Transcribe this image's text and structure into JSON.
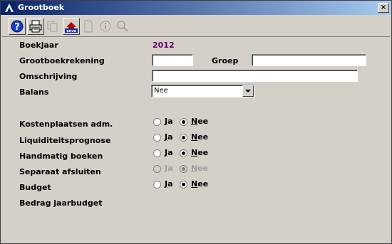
{
  "window": {
    "title": "Grootboek",
    "close": "×"
  },
  "toolbar": {
    "buttons": [
      {
        "icon": "help-icon",
        "enabled": true
      },
      {
        "icon": "print-icon",
        "enabled": true
      },
      {
        "icon": "copy-icon",
        "enabled": false
      },
      {
        "icon": "anva-icon",
        "enabled": true,
        "label": "anva"
      },
      {
        "icon": "new-document-icon",
        "enabled": false
      },
      {
        "icon": "info-icon",
        "enabled": false
      },
      {
        "icon": "search-icon",
        "enabled": false
      }
    ]
  },
  "form": {
    "boekjaar_label": "Boekjaar",
    "boekjaar_value": "2012",
    "grootboekrekening_label": "Grootboekrekening",
    "grootboekrekening_value": "",
    "groep_label": "Groep",
    "groep_value": "",
    "omschrijving_label": "Omschrijving",
    "omschrijving_value": "",
    "balans_label": "Balans",
    "balans_value": "Nee",
    "kostenplaatsen_label": "Kostenplaatsen  adm.",
    "liquiditeit_label": "Liquiditeitsprognose",
    "handmatig_label": "Handmatig boeken",
    "separaat_label": "Separaat afsluiten",
    "budget_label": "Budget",
    "jaarbudget_label": "Bedrag jaarbudget",
    "ja_first": "J",
    "ja_rest": "a",
    "nee_first": "N",
    "nee_rest": "ee"
  }
}
